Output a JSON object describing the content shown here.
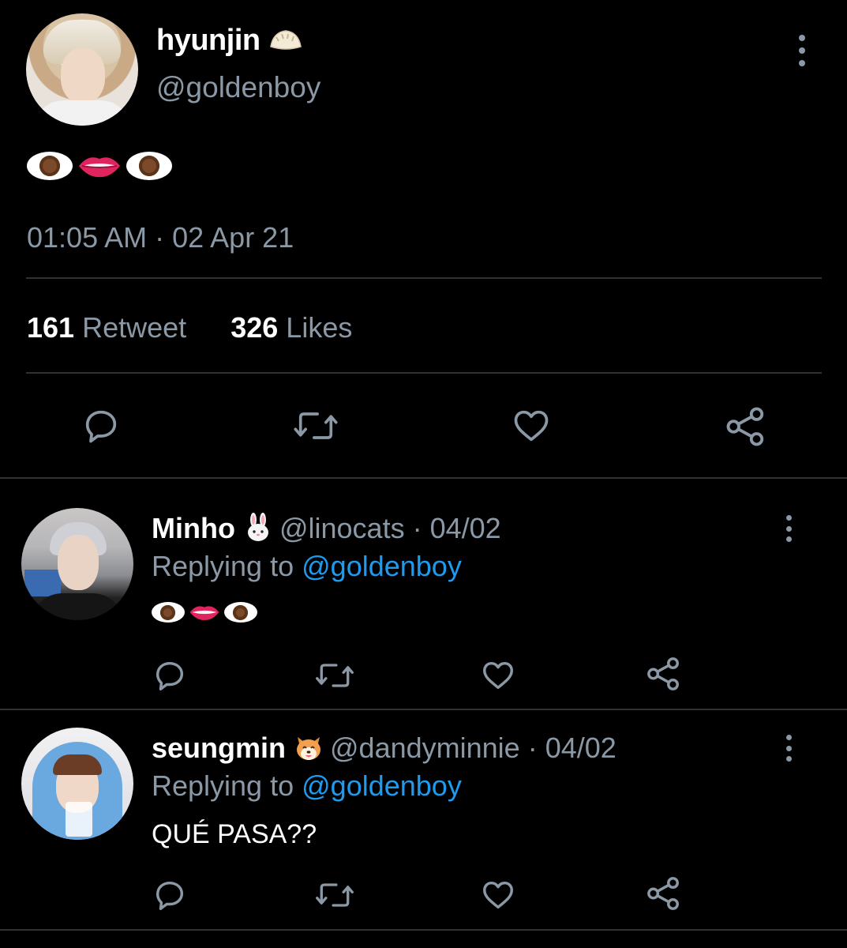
{
  "main_tweet": {
    "author_name": "hyunjin",
    "author_emoji": "dumpling-icon",
    "author_handle": "@goldenboy",
    "body_emoji": [
      "eyes-icon",
      "lips-icon",
      "eyes-icon"
    ],
    "timestamp": "01:05 AM · 02 Apr 21",
    "retweet_count": "161",
    "retweet_label": "Retweet",
    "like_count": "326",
    "like_label": "Likes",
    "actions": [
      "reply-icon",
      "retweet-icon",
      "like-icon",
      "share-icon"
    ]
  },
  "replies": [
    {
      "name": "Minho",
      "emoji": "rabbit-icon",
      "handle_date": "@linocats · 04/02",
      "replying_prefix": "Replying to",
      "replying_handle": "@goldenboy",
      "body_emoji": [
        "eyes-icon",
        "lips-icon",
        "eyes-icon"
      ]
    },
    {
      "name": "seungmin",
      "emoji": "dog-icon",
      "handle_date": "@dandyminnie · 04/02",
      "replying_prefix": "Replying to",
      "replying_handle": "@goldenboy",
      "text": "QUÉ PASA??"
    }
  ],
  "colors": {
    "background": "#000000",
    "muted_text": "#8b98a5",
    "link": "#1d9bf0",
    "divider": "#2f3336"
  }
}
